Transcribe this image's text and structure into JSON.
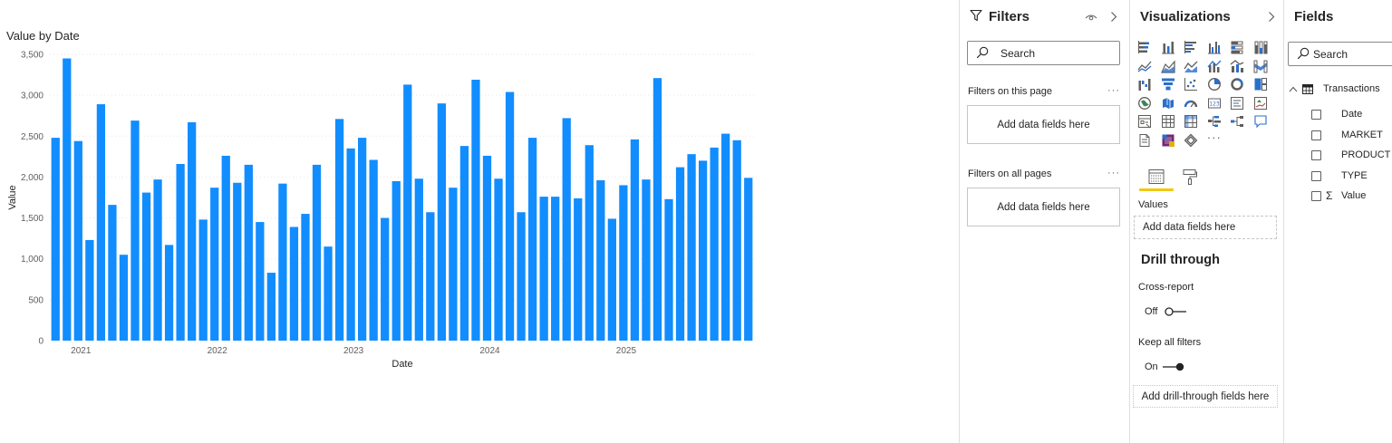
{
  "report": {
    "chart_title": "Value by Date"
  },
  "chart_data": {
    "type": "bar",
    "title": "Value by Date",
    "xlabel": "Date",
    "ylabel": "Value",
    "ylim": [
      0,
      3500
    ],
    "yticks": [
      0,
      500,
      1000,
      1500,
      2000,
      2500,
      3000,
      3500
    ],
    "ytick_labels": [
      "0",
      "500",
      "1,000",
      "1,500",
      "2,000",
      "2,500",
      "3,000",
      "3,500"
    ],
    "xtick_labels": [
      "2021",
      "2022",
      "2023",
      "2024",
      "2025"
    ],
    "xtick_first_bar_index": [
      2,
      14,
      26,
      38,
      50
    ],
    "gridlines": true,
    "bar_color": "#118DFF",
    "series": [
      {
        "values": [
          2480,
          3450,
          2440,
          1230,
          2890,
          1660,
          1050,
          2690,
          1810,
          1970,
          1170,
          2160,
          2670,
          1480,
          1870,
          2260,
          1930,
          2150,
          1450,
          830,
          1920,
          1390,
          1550,
          2150,
          1150,
          2710,
          2350,
          2480,
          2210,
          1500,
          1950,
          3130,
          1980,
          1570,
          2900,
          1870,
          2380,
          3190,
          2260,
          1980,
          3040,
          1570,
          2480,
          1760,
          1760,
          2720,
          1740,
          2390,
          1960,
          1490,
          1900,
          2460,
          1970,
          3210,
          1730,
          2120,
          2280,
          2200,
          2360,
          2530,
          2450,
          1990
        ]
      }
    ]
  },
  "filters_pane": {
    "title": "Filters",
    "search_placeholder": "Search",
    "page_section": "Filters on this page",
    "page_well": "Add data fields here",
    "all_section": "Filters on all pages",
    "all_well": "Add data fields here",
    "more": "···"
  },
  "viz_pane": {
    "title": "Visualizations",
    "values_label": "Values",
    "values_well": "Add data fields here",
    "drill_title": "Drill through",
    "cross_report_label": "Cross-report",
    "cross_report_state": "Off",
    "keep_filters_label": "Keep all filters",
    "keep_filters_state": "On",
    "drill_well": "Add drill-through fields here",
    "more_visuals": "···"
  },
  "fields_pane": {
    "title": "Fields",
    "search_placeholder": "Search",
    "table_name": "Transactions",
    "fields": [
      {
        "name": "Date",
        "sigma": false
      },
      {
        "name": "MARKET",
        "sigma": false
      },
      {
        "name": "PRODUCT",
        "sigma": false
      },
      {
        "name": "TYPE",
        "sigma": false
      },
      {
        "name": "Value",
        "sigma": true
      }
    ]
  }
}
